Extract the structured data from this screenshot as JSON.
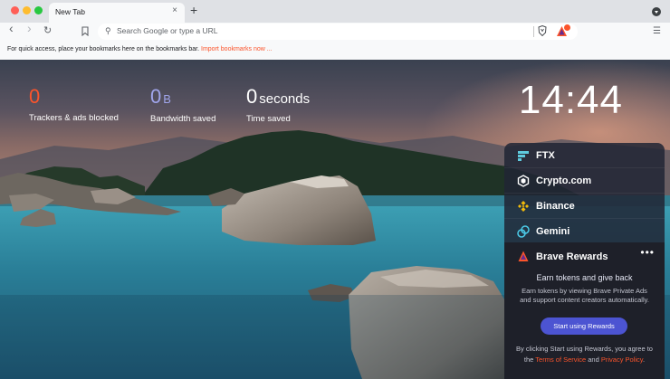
{
  "tabs": [
    {
      "title": "New Tab",
      "close": "×"
    }
  ],
  "new_tab": "+",
  "toolbar": {
    "back": "‹",
    "forward": "›",
    "reload": "↻",
    "placeholder": "Search Google or type a URL",
    "menu": "☰"
  },
  "bookmarks_bar": {
    "message": "For quick access, place your bookmarks here on the bookmarks bar.",
    "link": "Import bookmarks now ..."
  },
  "stats": {
    "trackers": {
      "value": "0",
      "label": "Trackers & ads blocked"
    },
    "bandwidth": {
      "value": "0",
      "unit": "B",
      "label": "Bandwidth saved"
    },
    "time": {
      "value": "0",
      "unit": "seconds",
      "label": "Time saved"
    }
  },
  "clock": "14:44",
  "widgets": [
    {
      "name": "FTX",
      "icon": "ftx-icon"
    },
    {
      "name": "Crypto.com",
      "icon": "crypto-com-icon"
    },
    {
      "name": "Binance",
      "icon": "binance-icon"
    },
    {
      "name": "Gemini",
      "icon": "gemini-icon"
    }
  ],
  "rewards": {
    "title": "Brave Rewards",
    "more": "•••",
    "heading": "Earn tokens and give back",
    "description": "Earn tokens by viewing Brave Private Ads and support content creators automatically.",
    "button": "Start using Rewards",
    "legal_pre": "By clicking Start using Rewards, you agree to the",
    "terms": "Terms of Service",
    "and": "and",
    "privacy": "Privacy Policy",
    "period": "."
  },
  "colors": {
    "brave_orange": "#fb542b",
    "rewards_button": "#4c54d2",
    "bandwidth_blue": "#a0a5eb"
  }
}
